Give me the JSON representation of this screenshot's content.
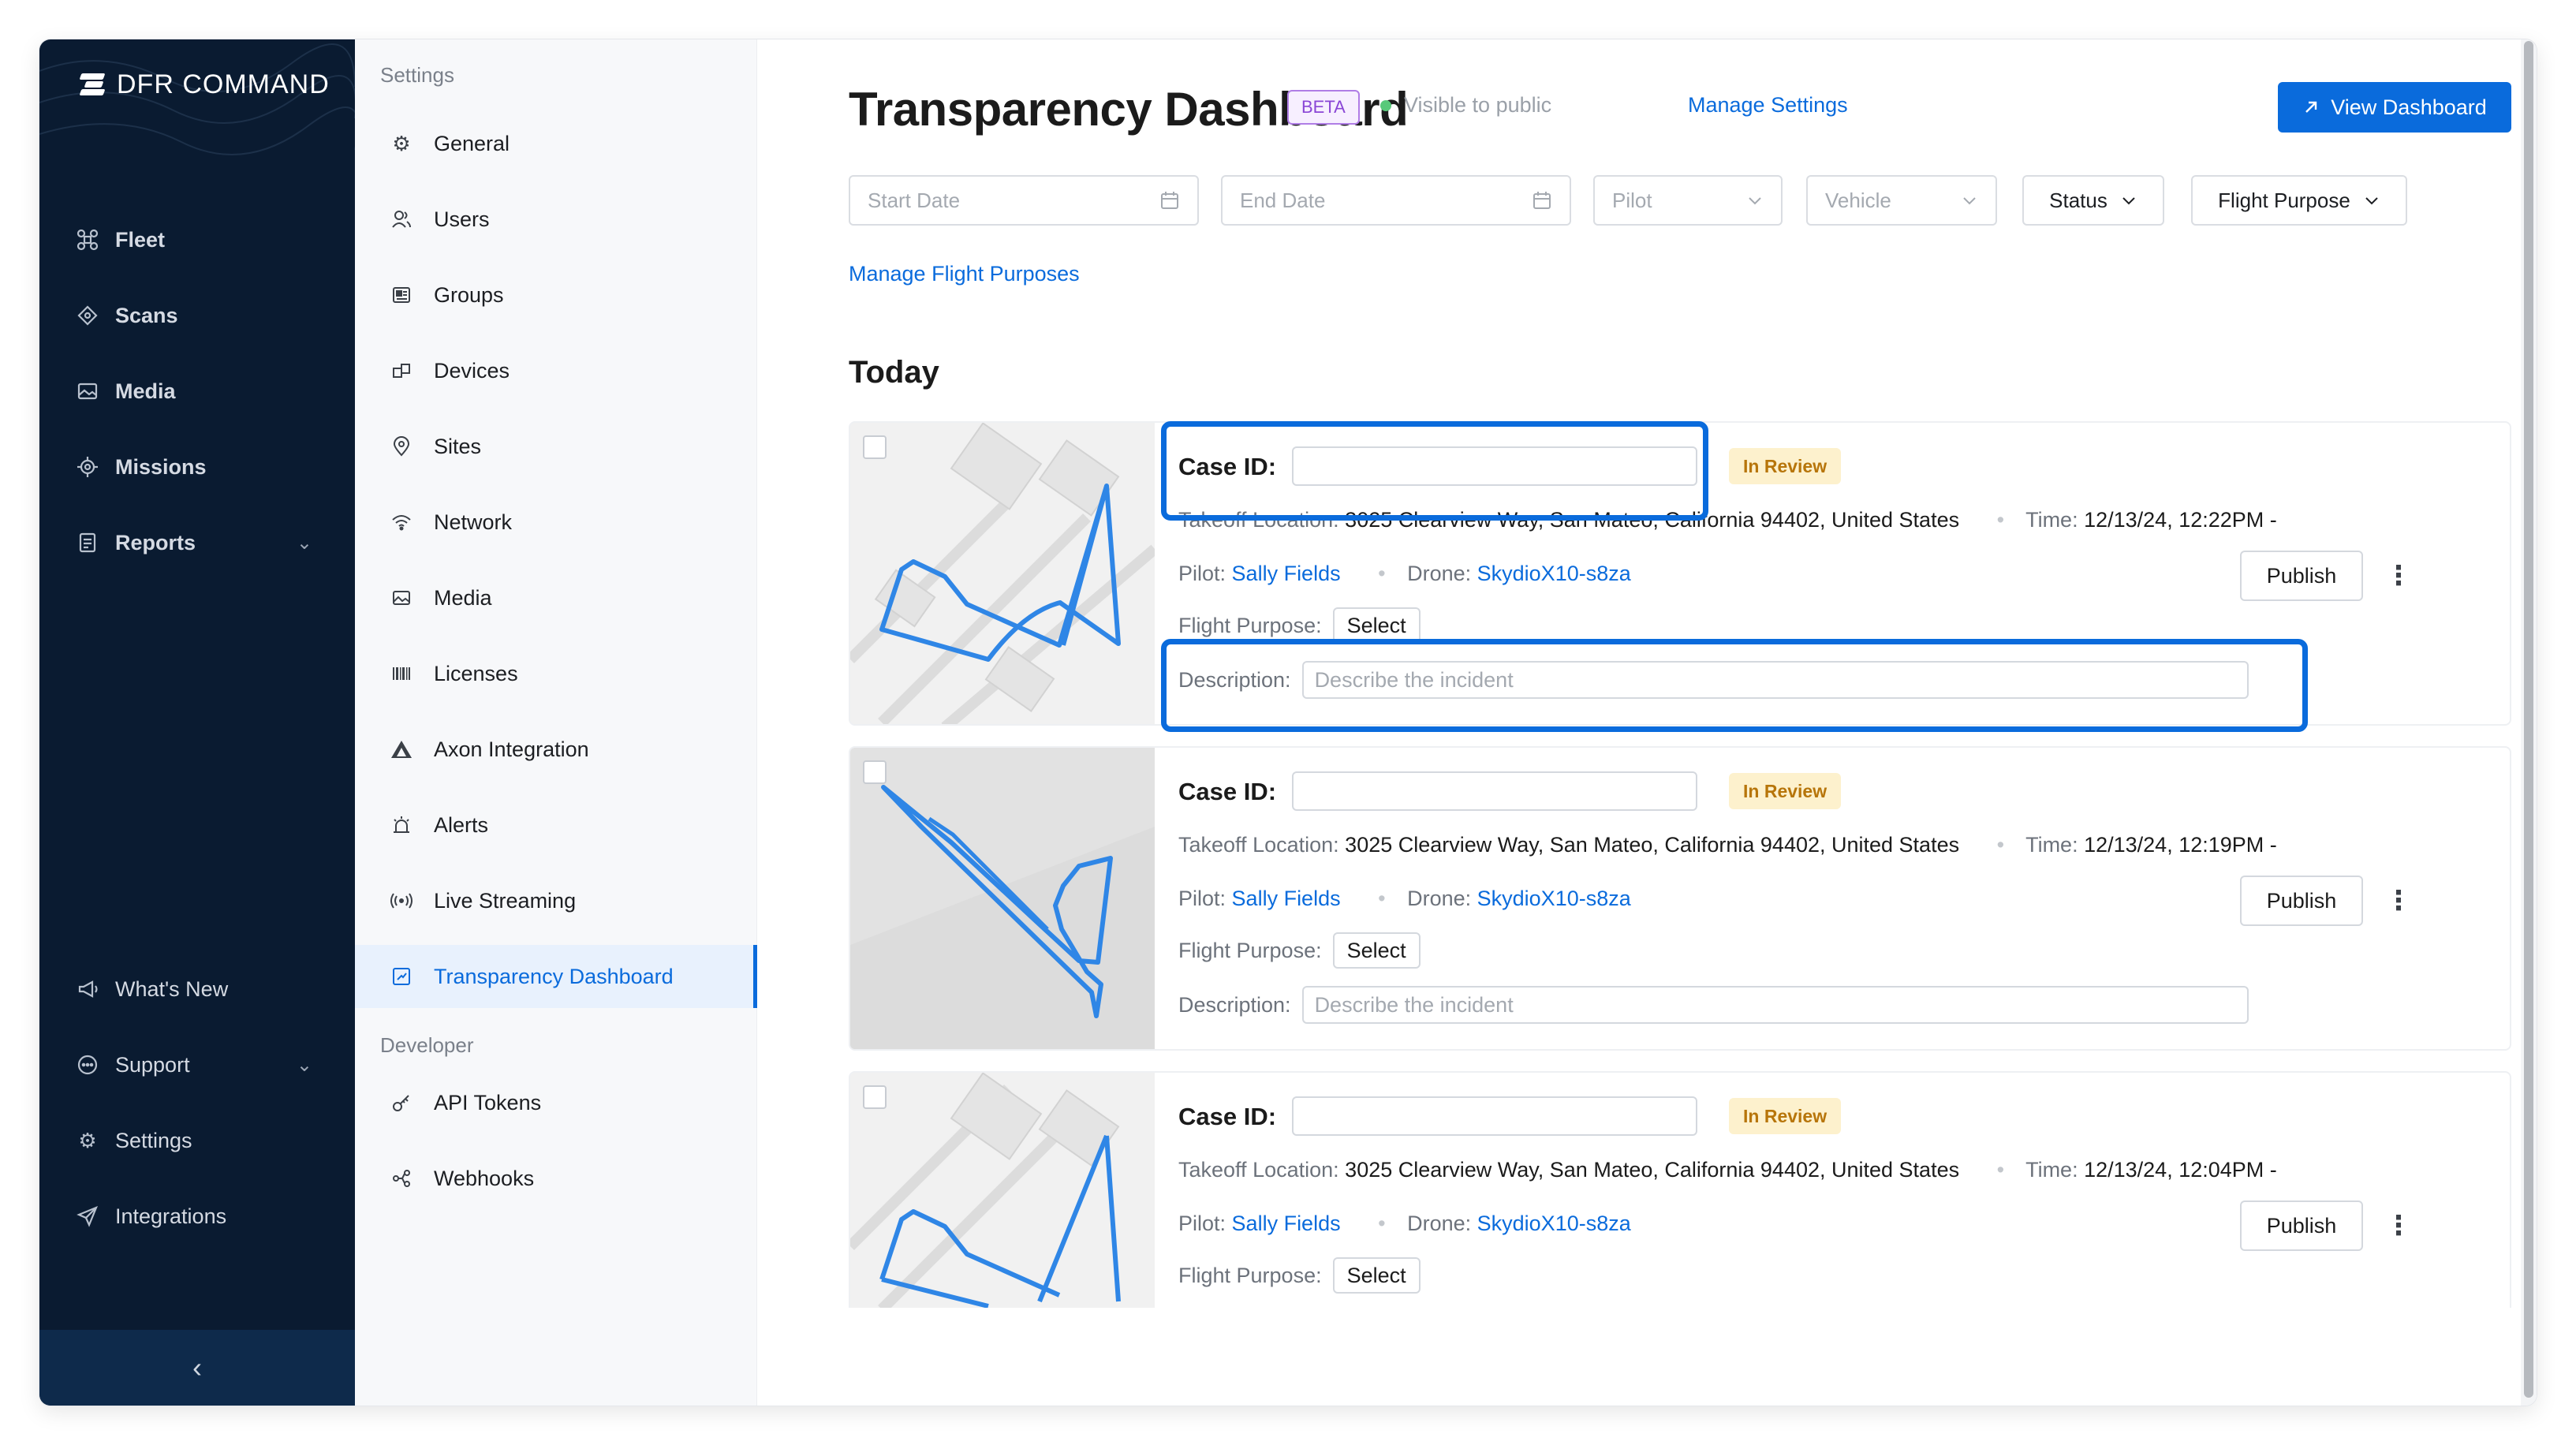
{
  "app": {
    "brand": "DFR COMMAND"
  },
  "leftnav": {
    "items": [
      {
        "label": "Fleet",
        "icon": "drone-icon"
      },
      {
        "label": "Scans",
        "icon": "scan-icon"
      },
      {
        "label": "Media",
        "icon": "image-icon"
      },
      {
        "label": "Missions",
        "icon": "target-icon"
      },
      {
        "label": "Reports",
        "icon": "report-icon"
      }
    ],
    "bottom_items": [
      {
        "label": "What's New",
        "icon": "megaphone-icon"
      },
      {
        "label": "Support",
        "icon": "chat-icon"
      },
      {
        "label": "Settings",
        "icon": "gear-icon"
      },
      {
        "label": "Integrations",
        "icon": "send-icon"
      }
    ],
    "collapse_glyph": "‹"
  },
  "settings_nav": {
    "section_settings": "Settings",
    "items": [
      {
        "label": "General",
        "icon": "gear-icon"
      },
      {
        "label": "Users",
        "icon": "users-icon"
      },
      {
        "label": "Groups",
        "icon": "groups-icon"
      },
      {
        "label": "Devices",
        "icon": "devices-icon"
      },
      {
        "label": "Sites",
        "icon": "location-pin-icon"
      },
      {
        "label": "Network",
        "icon": "wifi-icon"
      },
      {
        "label": "Media",
        "icon": "image-icon"
      },
      {
        "label": "Licenses",
        "icon": "barcode-icon"
      },
      {
        "label": "Axon Integration",
        "icon": "axon-icon"
      },
      {
        "label": "Alerts",
        "icon": "siren-icon"
      },
      {
        "label": "Live Streaming",
        "icon": "broadcast-icon"
      },
      {
        "label": "Transparency Dashboard",
        "icon": "dashboard-icon"
      }
    ],
    "active": "Transparency Dashboard",
    "section_developer": "Developer",
    "dev_items": [
      {
        "label": "API Tokens",
        "icon": "key-icon"
      },
      {
        "label": "Webhooks",
        "icon": "webhook-icon"
      }
    ]
  },
  "header": {
    "title": "Transparency Dashboard",
    "badge": "BETA",
    "visibility": "Visible to public",
    "manage_settings": "Manage Settings",
    "view_dashboard": "View Dashboard"
  },
  "filters": {
    "start_date": "Start Date",
    "end_date": "End Date",
    "pilot": "Pilot",
    "vehicle": "Vehicle",
    "status": "Status",
    "flight_purpose": "Flight Purpose"
  },
  "manage_flight_purposes": "Manage Flight Purposes",
  "section_title": "Today",
  "labels": {
    "case_id": "Case ID:",
    "takeoff": "Takeoff Location:",
    "time": "Time:",
    "pilot": "Pilot:",
    "drone": "Drone:",
    "flight_purpose": "Flight Purpose:",
    "select": "Select",
    "description": "Description:",
    "description_placeholder": "Describe the incident",
    "publish": "Publish",
    "separator": "•"
  },
  "flights": [
    {
      "status": "In Review",
      "takeoff_location": "3025 Clearview Way, San Mateo, California 94402, United States",
      "time": "12/13/24, 12:22PM -",
      "pilot": "Sally Fields",
      "drone": "SkydioX10-s8za"
    },
    {
      "status": "In Review",
      "takeoff_location": "3025 Clearview Way, San Mateo, California 94402, United States",
      "time": "12/13/24, 12:19PM -",
      "pilot": "Sally Fields",
      "drone": "SkydioX10-s8za"
    },
    {
      "status": "In Review",
      "takeoff_location": "3025 Clearview Way, San Mateo, California 94402, United States",
      "time": "12/13/24, 12:04PM -",
      "pilot": "Sally Fields",
      "drone": "SkydioX10-s8za"
    }
  ],
  "colors": {
    "accent": "#0a6bdc",
    "nav_bg": "#0a1b31",
    "highlight": "#0a6bdc",
    "review_bg": "#fdf1cd",
    "review_text": "#b7750a"
  }
}
